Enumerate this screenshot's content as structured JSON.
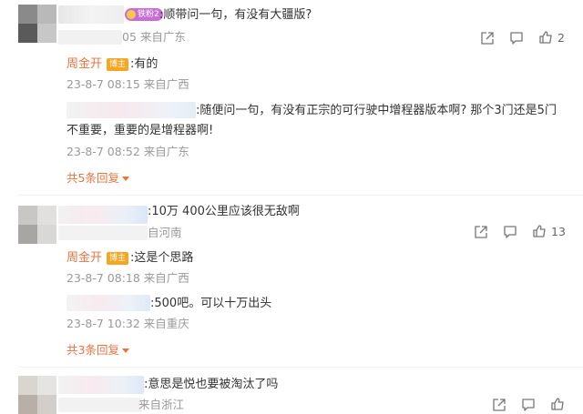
{
  "comments": [
    {
      "badge": "铁粉2",
      "text": ":顺带问一句，有没有大疆版?",
      "meta": "05 来自广东",
      "likes": "2"
    },
    {
      "text": ":10万 400公里应该很无敌啊",
      "meta": "自河南",
      "likes": "13"
    },
    {
      "text": ":意思是悦也要被淘汰了吗",
      "meta": "来自浙江"
    }
  ],
  "replies_1": [
    {
      "author": "周金开",
      "badge": "博主",
      "text": ":有的",
      "meta": "23-8-7 08:15 来自广西"
    },
    {
      "text_line1": ":随便问一句，有没有正宗的可行驶中增程器版本啊? 那个3门还是5门",
      "text_line2": "不重要，重要的是增程器啊!",
      "meta": "23-8-7 08:52 来自广东"
    }
  ],
  "more_1": "共5条回复",
  "replies_2": [
    {
      "author": "周金开",
      "badge": "博主",
      "text": ":这是个思路",
      "meta": "23-8-7 08:18 来自广西"
    },
    {
      "text": ":500吧。可以十万出头",
      "meta": "23-8-7 10:32 来自重庆"
    }
  ],
  "more_2": "共3条回复",
  "icons": [
    "share-icon",
    "comment-icon",
    "like-icon"
  ]
}
